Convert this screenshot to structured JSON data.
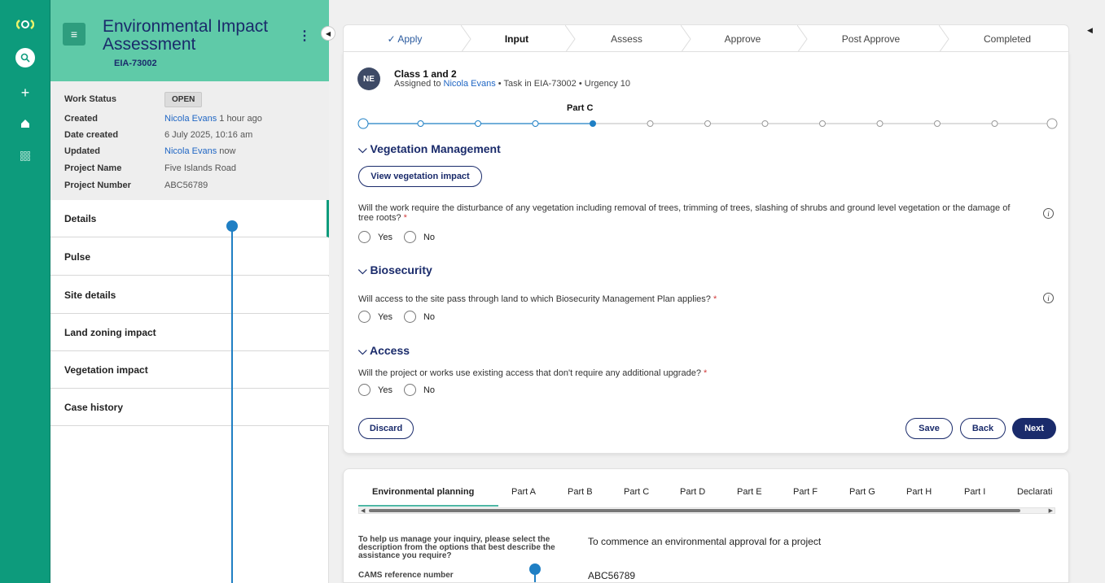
{
  "rail": {
    "logo_icon": "logo-icon",
    "icons": [
      "search-icon",
      "plus-icon",
      "home-icon",
      "apps-icon"
    ]
  },
  "case": {
    "title": "Environmental Impact Assessment",
    "id": "EIA-73002",
    "summary": {
      "work_status_label": "Work Status",
      "work_status_value": "OPEN",
      "created_label": "Created",
      "created_by": "Nicola Evans",
      "created_when": "1 hour ago",
      "date_created_label": "Date created",
      "date_created_value": "6 July 2025, 10:16 am",
      "updated_label": "Updated",
      "updated_by": "Nicola Evans",
      "updated_when": "now",
      "project_name_label": "Project Name",
      "project_name_value": "Five Islands Road",
      "project_number_label": "Project Number",
      "project_number_value": "ABC56789"
    },
    "nav": [
      "Details",
      "Pulse",
      "Site details",
      "Land zoning impact",
      "Vegetation impact",
      "Case history"
    ]
  },
  "stages": [
    "✓ Apply",
    "Input",
    "Assess",
    "Approve",
    "Post Approve",
    "Completed"
  ],
  "task": {
    "avatar": "NE",
    "title": "Class 1 and 2",
    "assigned_prefix": "Assigned to ",
    "assignee": "Nicola Evans",
    "meta_suffix": " • Task in EIA-73002 • Urgency 10",
    "part_label": "Part C",
    "progress_steps": 13,
    "current_step": 5
  },
  "form": {
    "veg_title": "Vegetation Management",
    "view_veg_button": "View vegetation impact",
    "veg_question": "Will the work require the disturbance of any vegetation including removal of trees, trimming of trees, slashing of shrubs and ground level vegetation or the damage of tree roots?",
    "bio_title": "Biosecurity",
    "bio_question": "Will access to the site pass through land to which Biosecurity Management Plan applies?",
    "access_title": "Access",
    "access_question": "Will the project or works use existing access that don't require any additional upgrade?",
    "required_mark": "*",
    "yes": "Yes",
    "no": "No",
    "info_glyph": "i"
  },
  "actions": {
    "discard": "Discard",
    "save": "Save",
    "back": "Back",
    "next": "Next"
  },
  "lower": {
    "tabs": [
      "Environmental planning",
      "Part A",
      "Part B",
      "Part C",
      "Part D",
      "Part E",
      "Part F",
      "Part G",
      "Part H",
      "Part I",
      "Declarati"
    ],
    "help_text": "To help us manage your inquiry, please select the description from the options that best describe the assistance you require?",
    "help_answer": "To commence an environmental approval for a project",
    "cams_label": "CAMS reference number",
    "cams_value": "ABC56789"
  },
  "colors": {
    "rail": "#0d9b7c",
    "header": "#5fcaa8",
    "navy": "#1a2b6b",
    "link": "#1f66c4",
    "connector": "#1f7fc4"
  }
}
